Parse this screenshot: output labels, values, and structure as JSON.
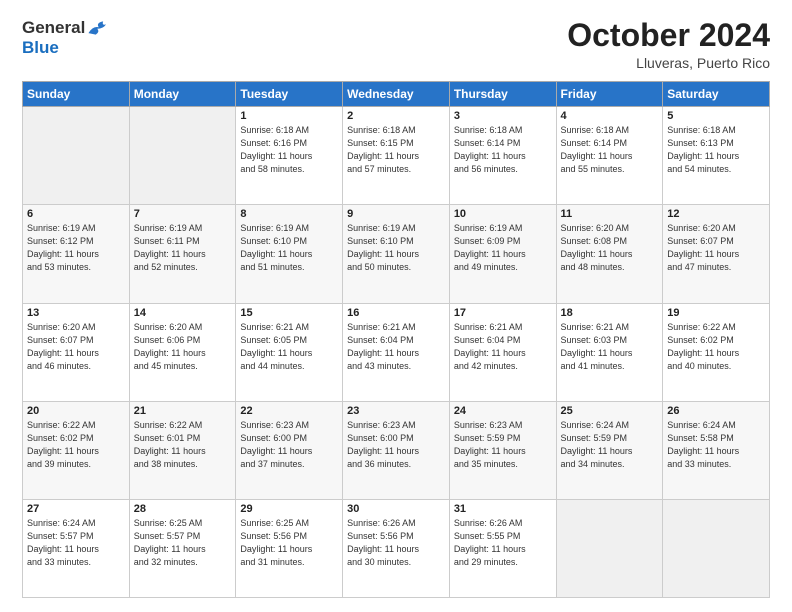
{
  "logo": {
    "general": "General",
    "blue": "Blue"
  },
  "title": "October 2024",
  "location": "Lluveras, Puerto Rico",
  "weekdays": [
    "Sunday",
    "Monday",
    "Tuesday",
    "Wednesday",
    "Thursday",
    "Friday",
    "Saturday"
  ],
  "weeks": [
    [
      {
        "day": "",
        "info": ""
      },
      {
        "day": "",
        "info": ""
      },
      {
        "day": "1",
        "info": "Sunrise: 6:18 AM\nSunset: 6:16 PM\nDaylight: 11 hours\nand 58 minutes."
      },
      {
        "day": "2",
        "info": "Sunrise: 6:18 AM\nSunset: 6:15 PM\nDaylight: 11 hours\nand 57 minutes."
      },
      {
        "day": "3",
        "info": "Sunrise: 6:18 AM\nSunset: 6:14 PM\nDaylight: 11 hours\nand 56 minutes."
      },
      {
        "day": "4",
        "info": "Sunrise: 6:18 AM\nSunset: 6:14 PM\nDaylight: 11 hours\nand 55 minutes."
      },
      {
        "day": "5",
        "info": "Sunrise: 6:18 AM\nSunset: 6:13 PM\nDaylight: 11 hours\nand 54 minutes."
      }
    ],
    [
      {
        "day": "6",
        "info": "Sunrise: 6:19 AM\nSunset: 6:12 PM\nDaylight: 11 hours\nand 53 minutes."
      },
      {
        "day": "7",
        "info": "Sunrise: 6:19 AM\nSunset: 6:11 PM\nDaylight: 11 hours\nand 52 minutes."
      },
      {
        "day": "8",
        "info": "Sunrise: 6:19 AM\nSunset: 6:10 PM\nDaylight: 11 hours\nand 51 minutes."
      },
      {
        "day": "9",
        "info": "Sunrise: 6:19 AM\nSunset: 6:10 PM\nDaylight: 11 hours\nand 50 minutes."
      },
      {
        "day": "10",
        "info": "Sunrise: 6:19 AM\nSunset: 6:09 PM\nDaylight: 11 hours\nand 49 minutes."
      },
      {
        "day": "11",
        "info": "Sunrise: 6:20 AM\nSunset: 6:08 PM\nDaylight: 11 hours\nand 48 minutes."
      },
      {
        "day": "12",
        "info": "Sunrise: 6:20 AM\nSunset: 6:07 PM\nDaylight: 11 hours\nand 47 minutes."
      }
    ],
    [
      {
        "day": "13",
        "info": "Sunrise: 6:20 AM\nSunset: 6:07 PM\nDaylight: 11 hours\nand 46 minutes."
      },
      {
        "day": "14",
        "info": "Sunrise: 6:20 AM\nSunset: 6:06 PM\nDaylight: 11 hours\nand 45 minutes."
      },
      {
        "day": "15",
        "info": "Sunrise: 6:21 AM\nSunset: 6:05 PM\nDaylight: 11 hours\nand 44 minutes."
      },
      {
        "day": "16",
        "info": "Sunrise: 6:21 AM\nSunset: 6:04 PM\nDaylight: 11 hours\nand 43 minutes."
      },
      {
        "day": "17",
        "info": "Sunrise: 6:21 AM\nSunset: 6:04 PM\nDaylight: 11 hours\nand 42 minutes."
      },
      {
        "day": "18",
        "info": "Sunrise: 6:21 AM\nSunset: 6:03 PM\nDaylight: 11 hours\nand 41 minutes."
      },
      {
        "day": "19",
        "info": "Sunrise: 6:22 AM\nSunset: 6:02 PM\nDaylight: 11 hours\nand 40 minutes."
      }
    ],
    [
      {
        "day": "20",
        "info": "Sunrise: 6:22 AM\nSunset: 6:02 PM\nDaylight: 11 hours\nand 39 minutes."
      },
      {
        "day": "21",
        "info": "Sunrise: 6:22 AM\nSunset: 6:01 PM\nDaylight: 11 hours\nand 38 minutes."
      },
      {
        "day": "22",
        "info": "Sunrise: 6:23 AM\nSunset: 6:00 PM\nDaylight: 11 hours\nand 37 minutes."
      },
      {
        "day": "23",
        "info": "Sunrise: 6:23 AM\nSunset: 6:00 PM\nDaylight: 11 hours\nand 36 minutes."
      },
      {
        "day": "24",
        "info": "Sunrise: 6:23 AM\nSunset: 5:59 PM\nDaylight: 11 hours\nand 35 minutes."
      },
      {
        "day": "25",
        "info": "Sunrise: 6:24 AM\nSunset: 5:59 PM\nDaylight: 11 hours\nand 34 minutes."
      },
      {
        "day": "26",
        "info": "Sunrise: 6:24 AM\nSunset: 5:58 PM\nDaylight: 11 hours\nand 33 minutes."
      }
    ],
    [
      {
        "day": "27",
        "info": "Sunrise: 6:24 AM\nSunset: 5:57 PM\nDaylight: 11 hours\nand 33 minutes."
      },
      {
        "day": "28",
        "info": "Sunrise: 6:25 AM\nSunset: 5:57 PM\nDaylight: 11 hours\nand 32 minutes."
      },
      {
        "day": "29",
        "info": "Sunrise: 6:25 AM\nSunset: 5:56 PM\nDaylight: 11 hours\nand 31 minutes."
      },
      {
        "day": "30",
        "info": "Sunrise: 6:26 AM\nSunset: 5:56 PM\nDaylight: 11 hours\nand 30 minutes."
      },
      {
        "day": "31",
        "info": "Sunrise: 6:26 AM\nSunset: 5:55 PM\nDaylight: 11 hours\nand 29 minutes."
      },
      {
        "day": "",
        "info": ""
      },
      {
        "day": "",
        "info": ""
      }
    ]
  ]
}
